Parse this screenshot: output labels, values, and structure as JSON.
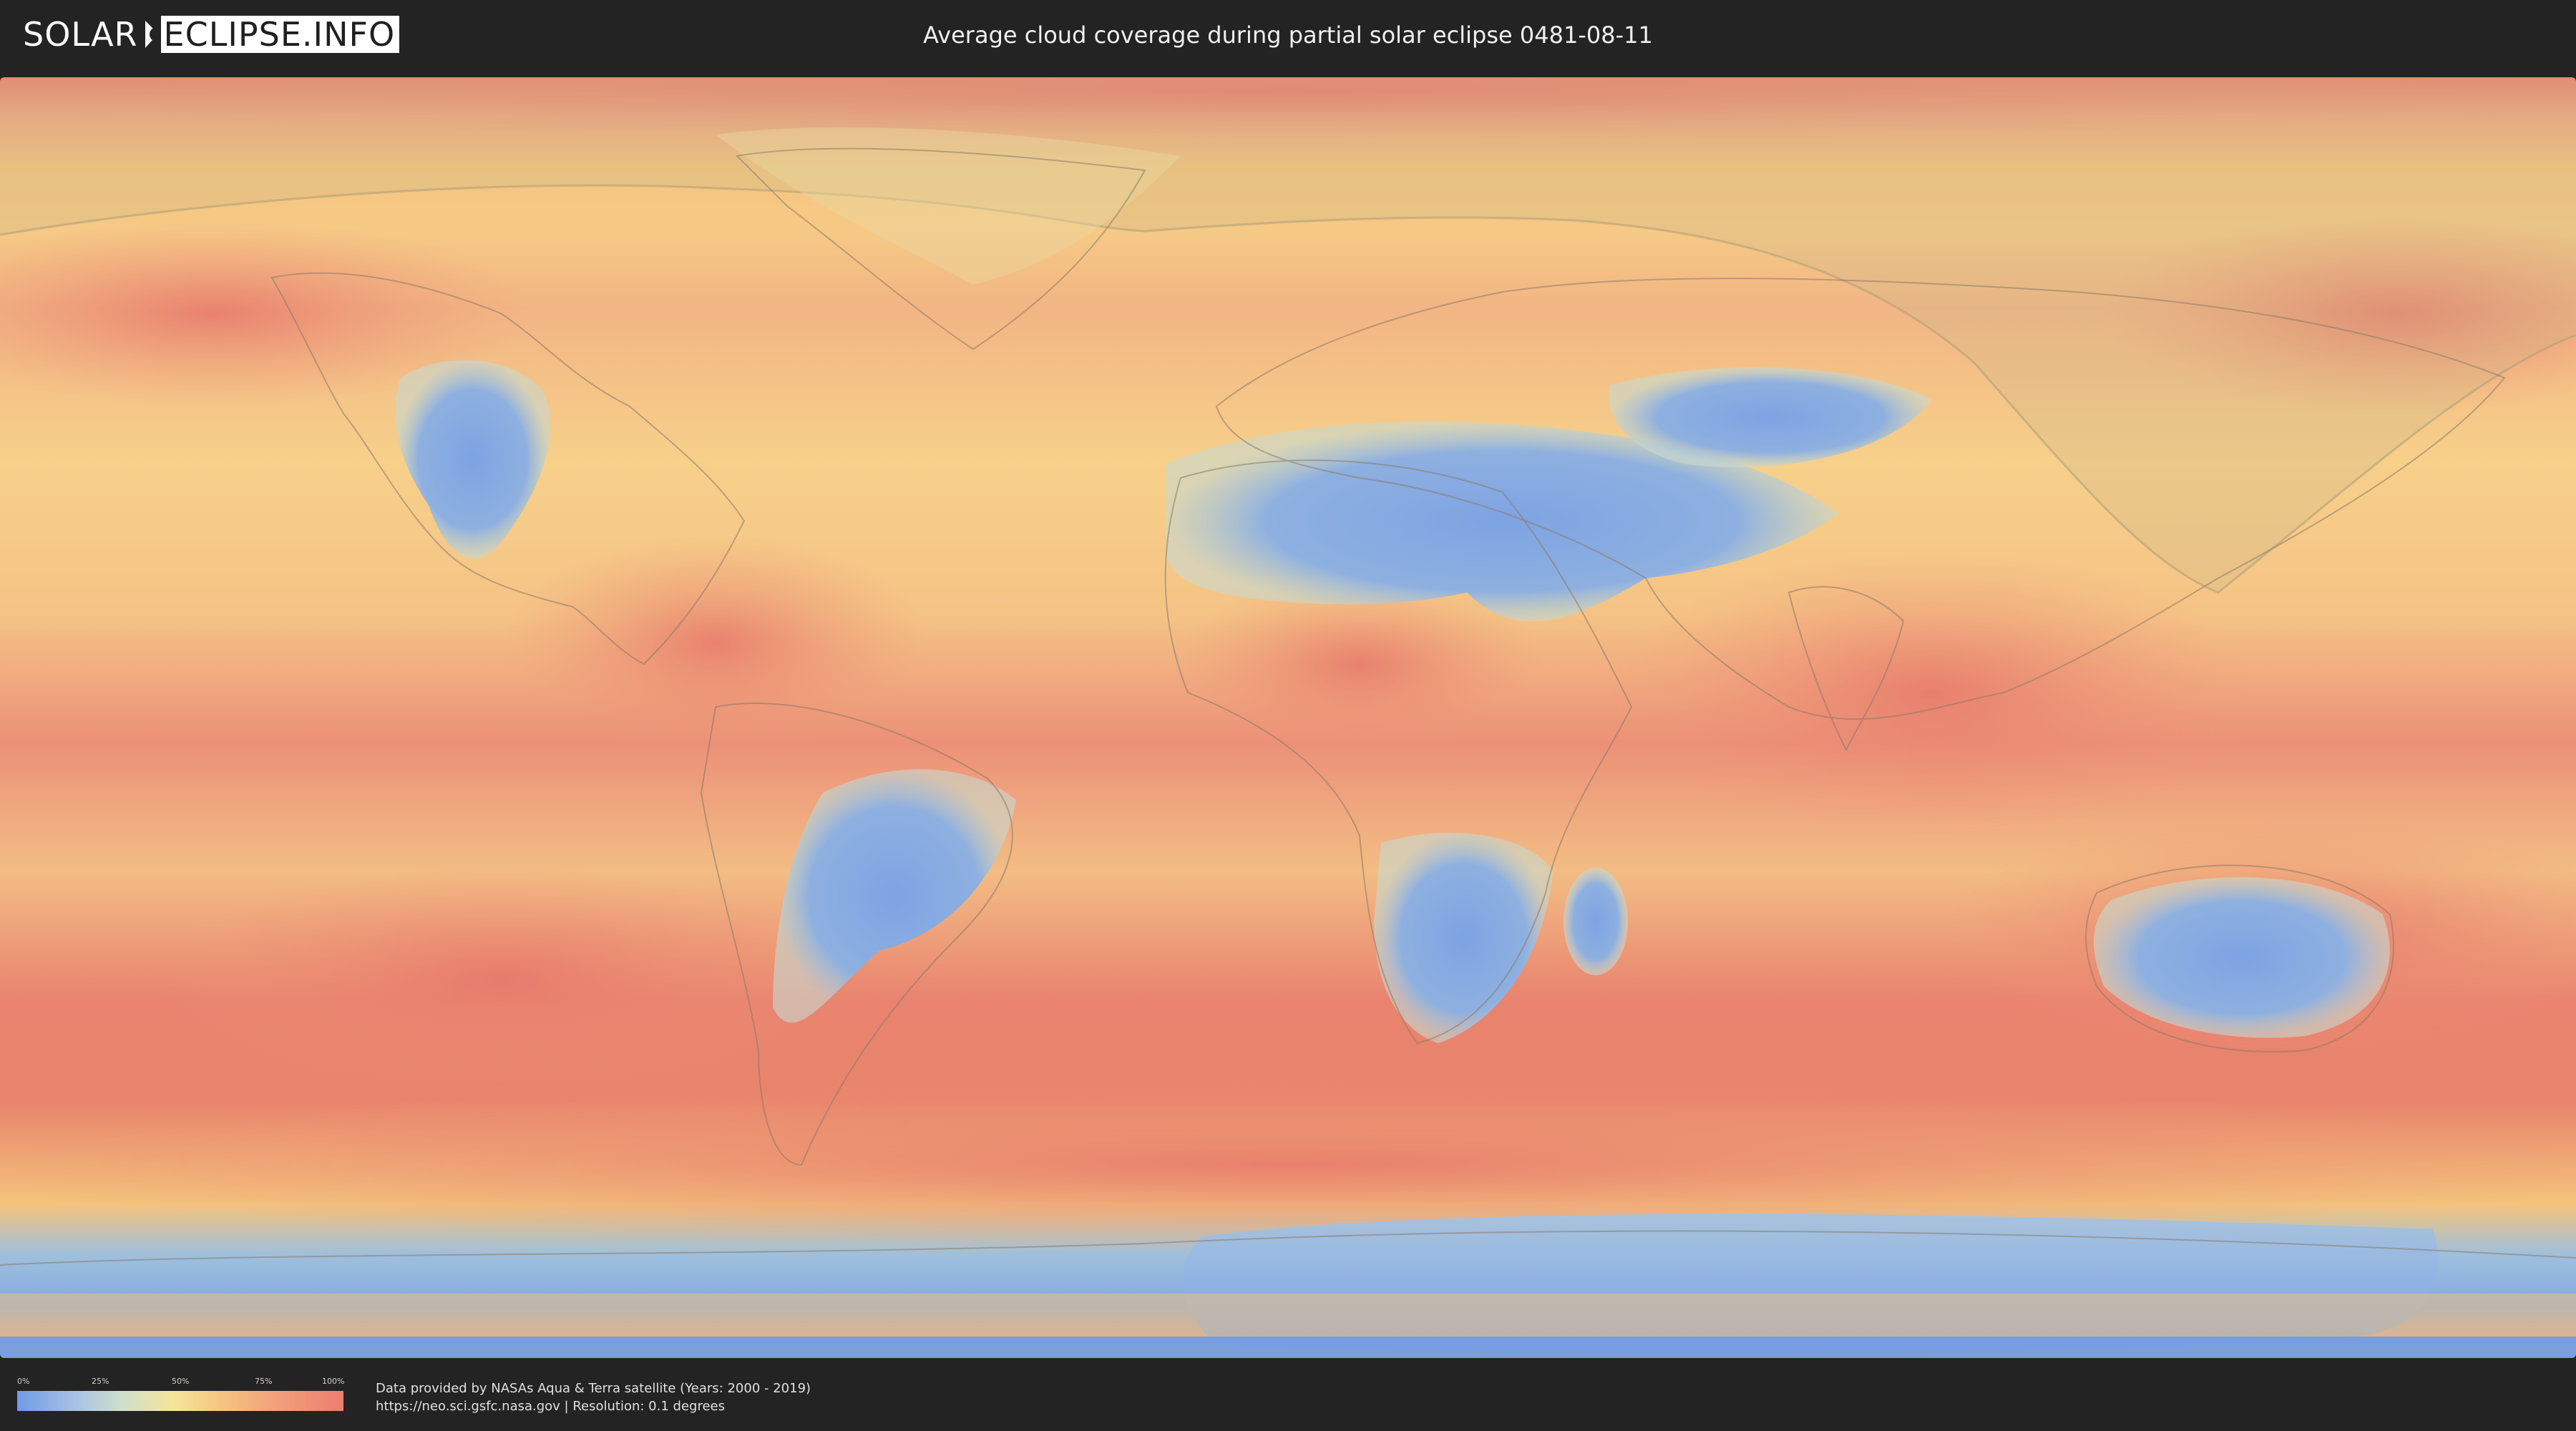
{
  "header": {
    "logo_solar": "SOLAR",
    "logo_eclipse": "ECLIPSE.INFO",
    "title": "Average cloud coverage during partial solar eclipse 0481-08-11"
  },
  "map": {
    "projection": "equirectangular",
    "layer": "cloud coverage",
    "colors": {
      "low_cloud": "#7fa4e2",
      "mid_cloud": "#f6e49a",
      "high_cloud": "#e97c6c",
      "eclipse_overlay": "#c9b78a"
    },
    "eclipse_region": "partial eclipse visibility zone (northern Pacific / east Asia / Greenland)"
  },
  "legend": {
    "ticks": [
      "0%",
      "25%",
      "50%",
      "75%",
      "100%"
    ]
  },
  "footer": {
    "source_line": "Data provided by NASAs Aqua & Terra satellite (Years: 2000 - 2019)",
    "url_line": "https://neo.sci.gsfc.nasa.gov | Resolution: 0.1 degrees"
  }
}
